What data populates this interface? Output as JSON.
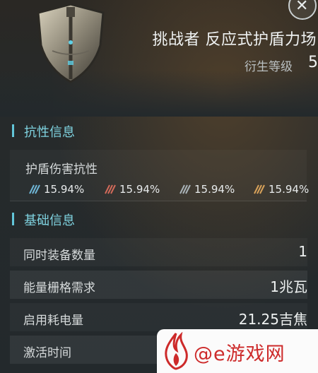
{
  "item": {
    "name": "挑战者 反应式护盾力场",
    "tier_label": "衍生等级",
    "tier_value": "5"
  },
  "close_icon": "close-icon",
  "sections": {
    "resistance": {
      "title": "抗性信息",
      "subtitle": "护盾伤害抗性",
      "items": [
        {
          "icon": "em-damage-icon",
          "value": "15.94%",
          "color": "#6fb6d6"
        },
        {
          "icon": "thermal-damage-icon",
          "value": "15.94%",
          "color": "#d26a5a"
        },
        {
          "icon": "kinetic-damage-icon",
          "value": "15.94%",
          "color": "#a9b3b8"
        },
        {
          "icon": "explosive-damage-icon",
          "value": "15.94%",
          "color": "#d8a25a"
        }
      ]
    },
    "basic": {
      "title": "基础信息",
      "rows": [
        {
          "label": "同时装备数量",
          "value": "1"
        },
        {
          "label": "能量栅格需求",
          "value": "1兆瓦"
        },
        {
          "label": "启用耗电量",
          "value": "21.25吉焦"
        },
        {
          "label": "激活时间",
          "value": ""
        }
      ]
    }
  },
  "watermark": {
    "text": "@e游戏网",
    "color": "#cd2a2a"
  },
  "accent_color": "#62c6d9"
}
